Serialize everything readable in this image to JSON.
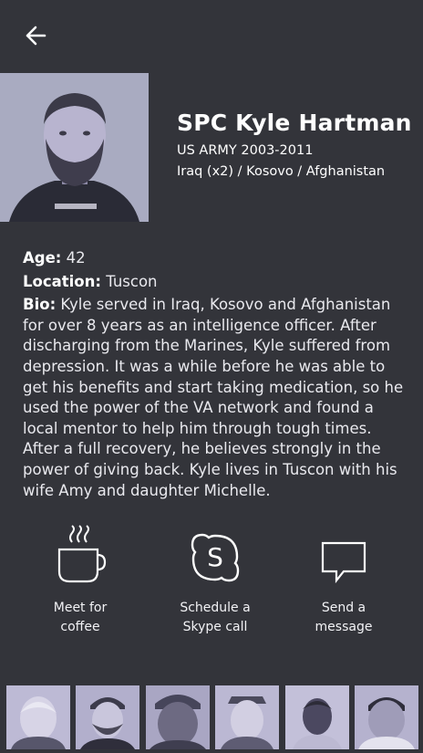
{
  "header": {
    "back_icon": "arrow-left-icon"
  },
  "profile": {
    "name": "SPC Kyle Hartman",
    "service": "US ARMY 2003-2011",
    "deployments": "Iraq (x2) / Kosovo / Afghanistan",
    "age_label": "Age:",
    "age_value": "42",
    "location_label": "Location:",
    "location_value": "Tuscon",
    "bio_label": "Bio:",
    "bio_text": "Kyle served in Iraq, Kosovo and Afghanistan for over 8 years as an intelligence officer. After discharging from the Marines, Kyle suffered from depression. It was a while before he was able to get his benefits and start taking medication, so he used the power of the VA network and found a local mentor to help him through tough times. After a full recovery, he believes strongly in the power of giving back. Kyle lives in Tuscon with his wife Amy and daughter Michelle."
  },
  "actions": [
    {
      "icon": "coffee-cup-icon",
      "line1": "Meet for",
      "line2": "coffee"
    },
    {
      "icon": "skype-icon",
      "line1": "Schedule a",
      "line2": "Skype call"
    },
    {
      "icon": "message-bubble-icon",
      "line1": "Send a",
      "line2": "message"
    }
  ],
  "colors": {
    "background": "#33343a",
    "text": "#ffffff",
    "photo_tint": "#b6b4d2"
  }
}
